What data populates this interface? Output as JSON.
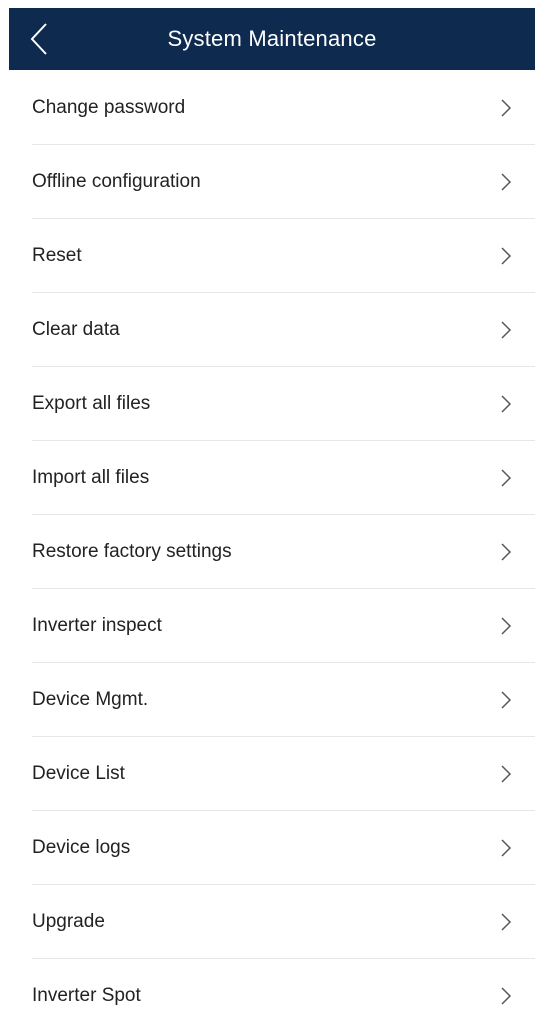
{
  "header": {
    "title": "System Maintenance",
    "back_icon": "chevron-left-icon",
    "background_color": "#0e2a4f"
  },
  "menu": {
    "items": [
      {
        "label": "Change password"
      },
      {
        "label": "Offline configuration"
      },
      {
        "label": "Reset"
      },
      {
        "label": "Clear data"
      },
      {
        "label": "Export all files"
      },
      {
        "label": "Import all files"
      },
      {
        "label": "Restore factory settings"
      },
      {
        "label": "Inverter inspect"
      },
      {
        "label": "Device Mgmt."
      },
      {
        "label": "Device List"
      },
      {
        "label": "Device logs"
      },
      {
        "label": "Upgrade"
      },
      {
        "label": "Inverter Spot"
      }
    ],
    "item_icon": "chevron-right-icon"
  }
}
